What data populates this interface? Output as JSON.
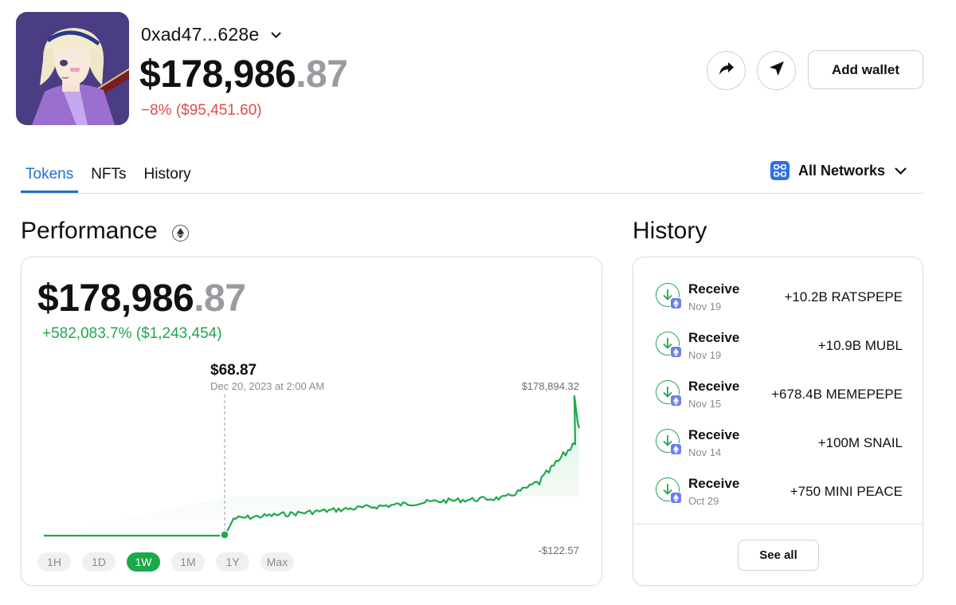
{
  "wallet": {
    "address": "0xad47...628e",
    "balance_main": "$178,986",
    "balance_cents": ".87",
    "change": "−8% ($95,451.60)",
    "add_wallet_label": "Add wallet"
  },
  "tabs": [
    {
      "label": "Tokens",
      "active": true
    },
    {
      "label": "NFTs",
      "active": false
    },
    {
      "label": "History",
      "active": false
    }
  ],
  "networks": {
    "label": "All Networks"
  },
  "performance": {
    "title": "Performance",
    "balance_main": "$178,986",
    "balance_cents": ".87",
    "gain": "+582,083.7% ($1,243,454)",
    "tooltip_value": "$68.87",
    "tooltip_date": "Dec 20, 2023 at 2:00 AM",
    "max_label": "$178,894.32",
    "min_label": "-$122.57",
    "ranges": [
      {
        "label": "1H",
        "active": false
      },
      {
        "label": "1D",
        "active": false
      },
      {
        "label": "1W",
        "active": true
      },
      {
        "label": "1M",
        "active": false
      },
      {
        "label": "1Y",
        "active": false
      },
      {
        "label": "Max",
        "active": false
      }
    ],
    "line_color": "#1ea84c"
  },
  "history": {
    "title": "History",
    "items": [
      {
        "type": "Receive",
        "date": "Nov 19",
        "amount": "+10.2B RATSPEPE"
      },
      {
        "type": "Receive",
        "date": "Nov 19",
        "amount": "+10.9B MUBL"
      },
      {
        "type": "Receive",
        "date": "Nov 15",
        "amount": "+678.4B MEMEPEPE"
      },
      {
        "type": "Receive",
        "date": "Nov 14",
        "amount": "+100M SNAIL"
      },
      {
        "type": "Receive",
        "date": "Oct 29",
        "amount": "+750 MINI PEACE"
      }
    ],
    "see_all_label": "See all"
  },
  "colors": {
    "accent_blue": "#1f6fd1",
    "positive_green": "#1ea84c",
    "negative_red": "#e24b4b",
    "network_blue": "#2f6fe0",
    "eth_badge": "#6b7ff0"
  },
  "icons": [
    "chevron-down-icon",
    "share-icon",
    "send-icon",
    "network-icon",
    "ethereum-icon",
    "receive-arrow-icon"
  ]
}
